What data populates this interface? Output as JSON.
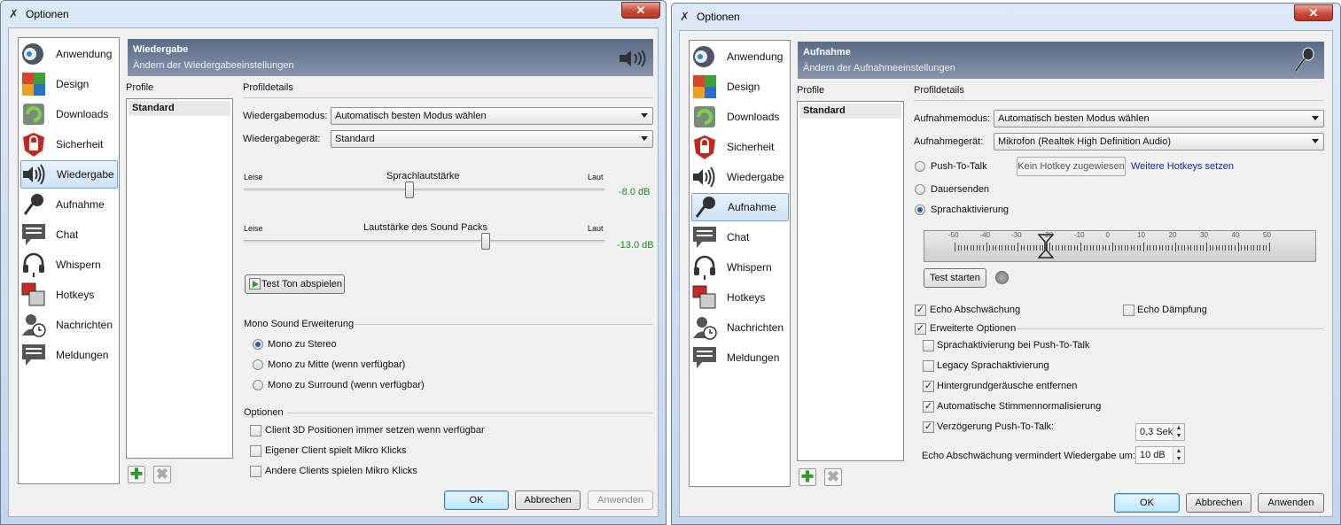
{
  "win1": {
    "title": "Optionen",
    "header_title": "Wiedergabe",
    "header_sub": "Ändern der Wiedergabeeinstellungen",
    "nav": [
      "Anwendung",
      "Design",
      "Downloads",
      "Sicherheit",
      "Wiedergabe",
      "Aufnahme",
      "Chat",
      "Whispern",
      "Hotkeys",
      "Nachrichten",
      "Meldungen"
    ],
    "selected_nav": "Wiedergabe",
    "profile_label": "Profile",
    "profile_item": "Standard",
    "details_label": "Profildetails",
    "mode_label": "Wiedergabemodus:",
    "mode_value": "Automatisch besten Modus wählen",
    "device_label": "Wiedergabegerät:",
    "device_value": "Standard",
    "slider1": {
      "left": "Leise",
      "title": "Sprachlautstärke",
      "right": "Laut",
      "value": "-8.0 dB",
      "level": 0.46
    },
    "slider2": {
      "left": "Leise",
      "title": "Lautstärke des Sound Packs",
      "right": "Laut",
      "value": "-13.0 dB",
      "level": 0.67
    },
    "test_button": "Test Ton abspielen",
    "mono_group": "Mono Sound Erweiterung",
    "mono_options": [
      "Mono zu Stereo",
      "Mono zu Mitte (wenn verfügbar)",
      "Mono zu Surround (wenn verfügbar)"
    ],
    "options_group": "Optionen",
    "checks": [
      "Client 3D Positionen immer setzen wenn verfügbar",
      "Eigener Client spielt Mikro Klicks",
      "Andere Clients spielen Mikro Klicks"
    ],
    "ok": "OK",
    "cancel": "Abbrechen",
    "apply": "Anwenden"
  },
  "win2": {
    "title": "Optionen",
    "header_title": "Aufnahme",
    "header_sub": "Ändern der Aufnahmeeinstellungen",
    "nav": [
      "Anwendung",
      "Design",
      "Downloads",
      "Sicherheit",
      "Wiedergabe",
      "Aufnahme",
      "Chat",
      "Whispern",
      "Hotkeys",
      "Nachrichten",
      "Meldungen"
    ],
    "selected_nav": "Aufnahme",
    "profile_label": "Profile",
    "profile_item": "Standard",
    "details_label": "Profildetails",
    "mode_label": "Aufnahmemodus:",
    "mode_value": "Automatisch besten Modus wählen",
    "device_label": "Aufnahmegerät:",
    "device_value": "Mikrofon (Realtek High Definition Audio)",
    "ptt": "Push-To-Talk",
    "hotkey_button": "Kein Hotkey zugewiesen",
    "more_hotkeys": "Weitere Hotkeys setzen",
    "continuous": "Dauersenden",
    "voice_activation": "Sprachaktivierung",
    "scale": [
      "-50",
      "-40",
      "-30",
      "-20",
      "-10",
      "0",
      "10",
      "20",
      "30",
      "40",
      "50"
    ],
    "threshold": -21,
    "test_button": "Test starten",
    "echo_cancel": "Echo Abschwächung",
    "echo_damp": "Echo Dämpfung",
    "advanced": "Erweiterte Optionen",
    "adv_checks": [
      {
        "label": "Sprachaktivierung bei Push-To-Talk",
        "checked": false
      },
      {
        "label": "Legacy Sprachaktivierung",
        "checked": false
      },
      {
        "label": "Hintergrundgeräusche entfernen",
        "checked": true
      },
      {
        "label": "Automatische Stimmennormalisierung",
        "checked": true
      },
      {
        "label": "Verzögerung Push-To-Talk:",
        "checked": true
      }
    ],
    "ptt_delay": "0,3 Sek",
    "echo_reduce_label": "Echo Abschwächung vermindert Wiedergabe um:",
    "echo_reduce_value": "10 dB",
    "ok": "OK",
    "cancel": "Abbrechen",
    "apply": "Anwenden"
  }
}
